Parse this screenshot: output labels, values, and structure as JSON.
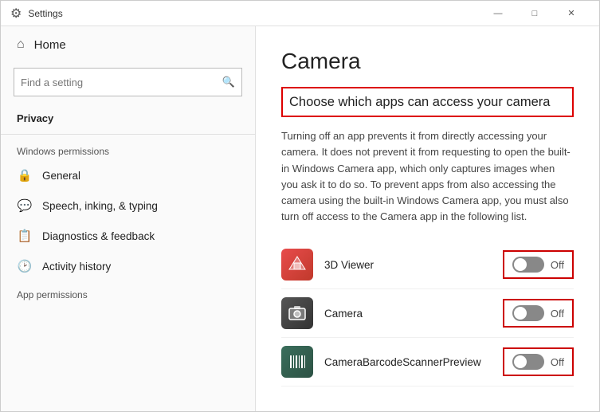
{
  "window": {
    "title": "Settings",
    "controls": {
      "minimize": "—",
      "maximize": "□",
      "close": "✕"
    }
  },
  "sidebar": {
    "home_label": "Home",
    "search_placeholder": "Find a setting",
    "privacy_label": "Privacy",
    "windows_permissions_label": "Windows permissions",
    "items": [
      {
        "label": "General",
        "icon": "🔒"
      },
      {
        "label": "Speech, inking, & typing",
        "icon": "🗨"
      },
      {
        "label": "Diagnostics & feedback",
        "icon": "🗒"
      },
      {
        "label": "Activity history",
        "icon": "🕑"
      }
    ],
    "app_permissions_label": "App permissions"
  },
  "main": {
    "page_title": "Camera",
    "section_heading": "Choose which apps can access your camera",
    "description": "Turning off an app prevents it from directly accessing your camera. It does not prevent it from requesting to open the built-in Windows Camera app, which only captures images when you ask it to do so. To prevent apps from also accessing the camera using the built-in Windows Camera app, you must also turn off access to the Camera app in the following list.",
    "apps": [
      {
        "name": "3D Viewer",
        "toggle_state": "Off",
        "icon_type": "3dviewer"
      },
      {
        "name": "Camera",
        "toggle_state": "Off",
        "icon_type": "camera"
      },
      {
        "name": "CameraBarcodeScannerPreview",
        "toggle_state": "Off",
        "icon_type": "barcode"
      }
    ]
  }
}
